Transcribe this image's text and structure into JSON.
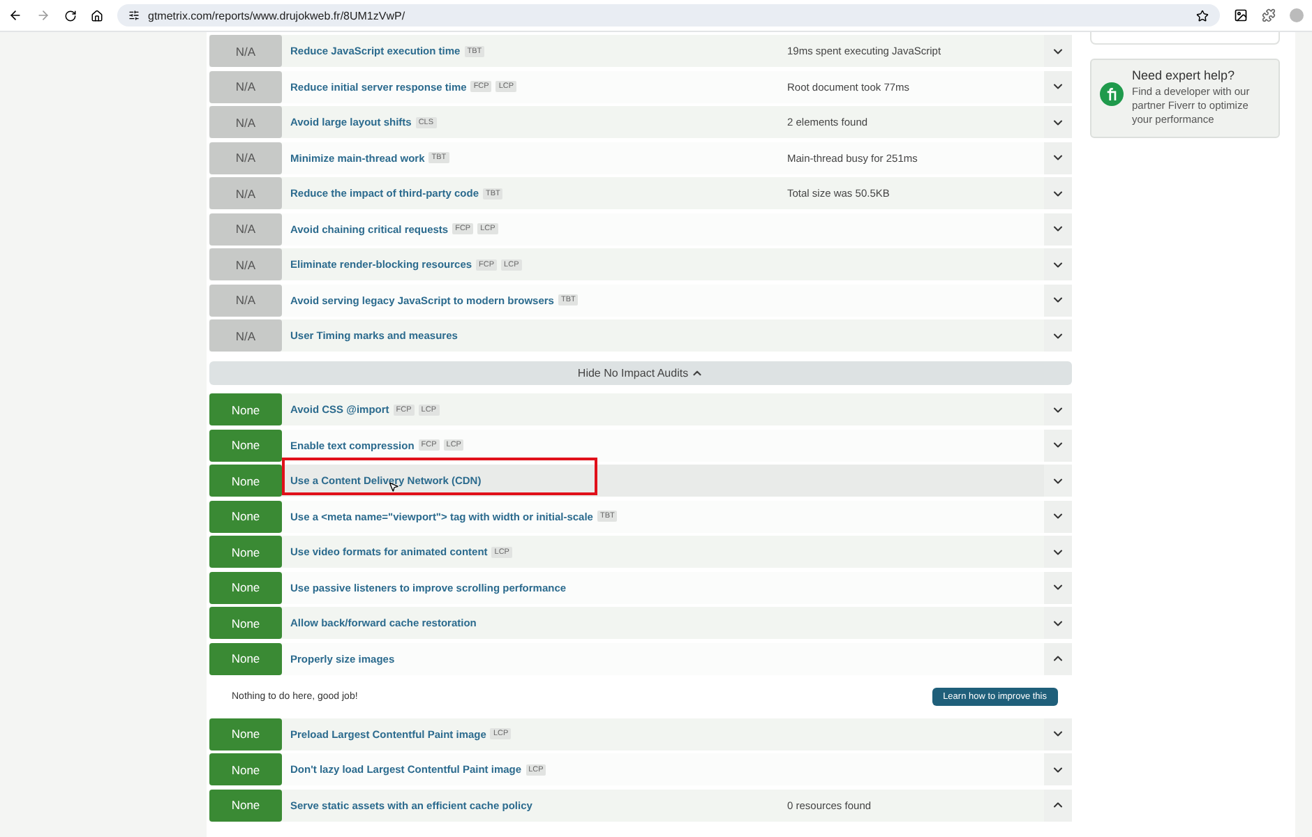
{
  "browser": {
    "url": "gtmetrix.com/reports/www.drujokweb.fr/8UM1zVwP/"
  },
  "audits_na": [
    {
      "kind": "na",
      "grade": "N/A",
      "title": "Reduce JavaScript execution time",
      "tags": [
        "TBT"
      ],
      "summary": "19ms spent executing JavaScript",
      "expanded": false
    },
    {
      "kind": "na",
      "grade": "N/A",
      "title": "Reduce initial server response time",
      "tags": [
        "FCP",
        "LCP"
      ],
      "summary": "Root document took 77ms",
      "expanded": false
    },
    {
      "kind": "na",
      "grade": "N/A",
      "title": "Avoid large layout shifts",
      "tags": [
        "CLS"
      ],
      "summary": "2 elements found",
      "expanded": false
    },
    {
      "kind": "na",
      "grade": "N/A",
      "title": "Minimize main-thread work",
      "tags": [
        "TBT"
      ],
      "summary": "Main-thread busy for 251ms",
      "expanded": false
    },
    {
      "kind": "na",
      "grade": "N/A",
      "title": "Reduce the impact of third-party code",
      "tags": [
        "TBT"
      ],
      "summary": "Total size was 50.5KB",
      "expanded": false
    },
    {
      "kind": "na",
      "grade": "N/A",
      "title": "Avoid chaining critical requests",
      "tags": [
        "FCP",
        "LCP"
      ],
      "expanded": false
    },
    {
      "kind": "na",
      "grade": "N/A",
      "title": "Eliminate render-blocking resources",
      "tags": [
        "FCP",
        "LCP"
      ],
      "expanded": false
    },
    {
      "kind": "na",
      "grade": "N/A",
      "title": "Avoid serving legacy JavaScript to modern browsers",
      "tags": [
        "TBT"
      ],
      "expanded": false
    },
    {
      "kind": "na",
      "grade": "N/A",
      "title": "User Timing marks and measures",
      "expanded": false
    }
  ],
  "toggle_button": "Hide No Impact Audits",
  "audits_none": [
    {
      "kind": "none",
      "grade": "None",
      "title": "Avoid CSS @import",
      "tags": [
        "FCP",
        "LCP"
      ],
      "expanded": false
    },
    {
      "kind": "none",
      "grade": "None",
      "title": "Enable text compression",
      "tags": [
        "FCP",
        "LCP"
      ],
      "expanded": false
    },
    {
      "kind": "none",
      "grade": "None",
      "title": "Use a Content Delivery Network (CDN)",
      "expanded": false,
      "highlighted": true
    },
    {
      "kind": "none",
      "grade": "None",
      "title": "Use a <meta name=\"viewport\"> tag with width or initial-scale",
      "tags": [
        "TBT"
      ],
      "expanded": false
    },
    {
      "kind": "none",
      "grade": "None",
      "title": "Use video formats for animated content",
      "tags": [
        "LCP"
      ],
      "expanded": false
    },
    {
      "kind": "none",
      "grade": "None",
      "title": "Use passive listeners to improve scrolling performance",
      "expanded": false
    },
    {
      "kind": "none",
      "grade": "None",
      "title": "Allow back/forward cache restoration",
      "expanded": false
    },
    {
      "kind": "none",
      "grade": "None",
      "title": "Properly size images",
      "expanded": true,
      "detail": {
        "message": "Nothing to do here, good job!",
        "button": "Learn how to improve this"
      }
    },
    {
      "kind": "none",
      "grade": "None",
      "title": "Preload Largest Contentful Paint image",
      "tags": [
        "LCP"
      ],
      "expanded": false
    },
    {
      "kind": "none",
      "grade": "None",
      "title": "Don't lazy load Largest Contentful Paint image",
      "tags": [
        "LCP"
      ],
      "expanded": false
    },
    {
      "kind": "none",
      "grade": "None",
      "title": "Serve static assets with an efficient cache policy",
      "summary": "0 resources found",
      "expanded": true
    }
  ],
  "help_card": {
    "title": "Need expert help?",
    "text": "Find a developer with our partner Fiverr to optimize your performance"
  }
}
